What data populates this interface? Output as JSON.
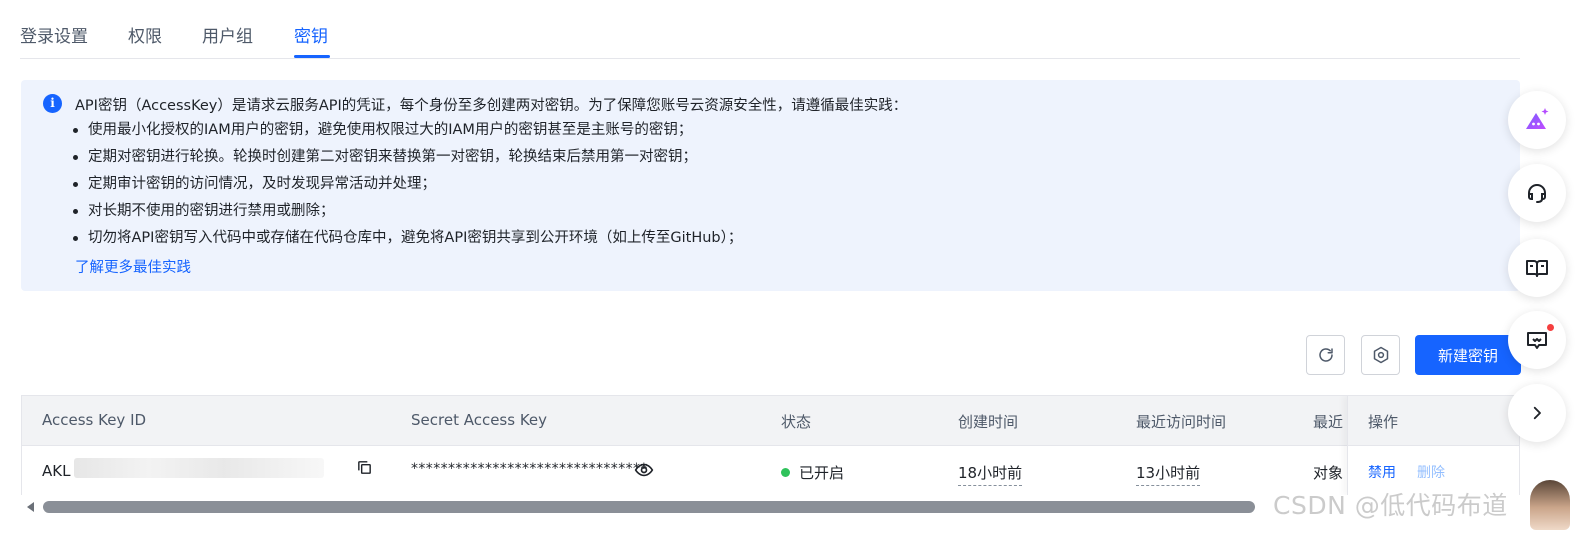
{
  "tabs": [
    {
      "label": "登录设置"
    },
    {
      "label": "权限"
    },
    {
      "label": "用户组"
    },
    {
      "label": "密钥"
    }
  ],
  "banner": {
    "icon": "info-icon",
    "title": "API密钥（AccessKey）是请求云服务API的凭证，每个身份至多创建两对密钥。为了保障您账号云资源安全性，请遵循最佳实践：",
    "items": [
      "使用最小化授权的IAM用户的密钥，避免使用权限过大的IAM用户的密钥甚至是主账号的密钥；",
      "定期对密钥进行轮换。轮换时创建第二对密钥来替换第一对密钥，轮换结束后禁用第一对密钥；",
      "定期审计密钥的访问情况，及时发现异常活动并处理；",
      "对长期不使用的密钥进行禁用或删除；",
      "切勿将API密钥写入代码中或存储在代码仓库中，避免将API密钥共享到公开环境（如上传至GitHub）；"
    ],
    "learn_more": "了解更多最佳实践"
  },
  "toolbar": {
    "refresh_icon": "refresh-icon",
    "settings_icon": "gear-icon",
    "new_key_label": "新建密钥"
  },
  "table": {
    "headers": {
      "access_key_id": "Access Key ID",
      "secret_access_key": "Secret Access Key",
      "status": "状态",
      "created": "创建时间",
      "last_access": "最近访问时间",
      "last_more": "最近",
      "ops": "操作"
    },
    "row": {
      "access_key_prefix": "AKL",
      "access_key_suffix": "...",
      "secret": "********************************",
      "status": "已开启",
      "created": "18小时前",
      "last_access": "13小时前",
      "last_more": "对象",
      "disable": "禁用",
      "delete": "删除"
    }
  },
  "watermark": "CSDN @低代码布道"
}
